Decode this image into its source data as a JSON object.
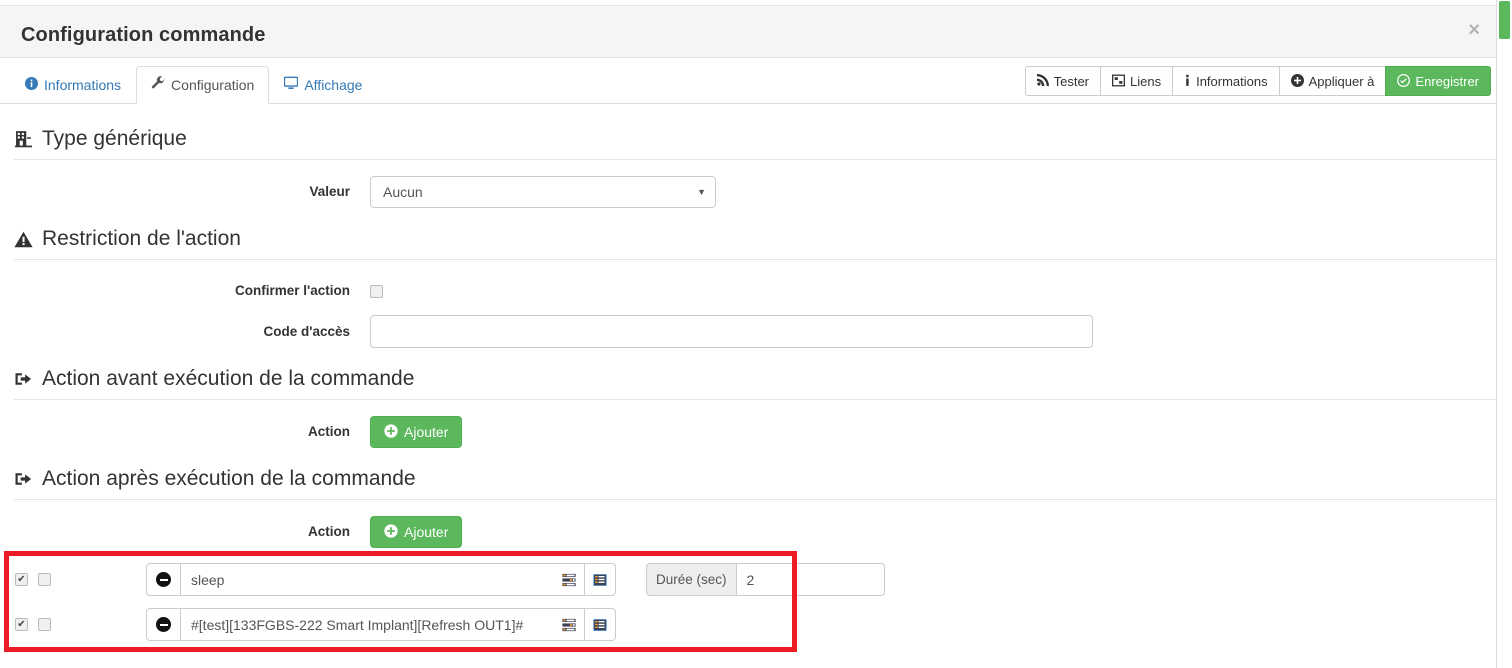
{
  "modal": {
    "title": "Configuration commande",
    "close_label": "×"
  },
  "tabs": [
    {
      "label": "Informations",
      "icon": "info-circle-icon",
      "active": false
    },
    {
      "label": "Configuration",
      "icon": "wrench-icon",
      "active": true
    },
    {
      "label": "Affichage",
      "icon": "desktop-icon",
      "active": false
    }
  ],
  "toolbar": {
    "test_label": "Tester",
    "links_label": "Liens",
    "informations_label": "Informations",
    "apply_to_label": "Appliquer à",
    "save_label": "Enregistrer",
    "save_color": "#5cb85c"
  },
  "sections": {
    "generic_type": {
      "title": "Type générique",
      "icon": "building-icon",
      "value_label": "Valeur",
      "value_selected": "Aucun"
    },
    "restriction": {
      "title": "Restriction de l'action",
      "icon": "warning-triangle-icon",
      "confirm_label": "Confirmer l'action",
      "confirm_checked": false,
      "access_code_label": "Code d'accès",
      "access_code_value": "",
      "access_code_placeholder": ""
    },
    "action_before": {
      "title": "Action avant exécution de la commande",
      "icon": "sign-out-icon",
      "action_label": "Action",
      "add_label": "Ajouter"
    },
    "action_after": {
      "title": "Action après exécution de la commande",
      "icon": "sign-out-icon",
      "action_label": "Action",
      "add_label": "Ajouter"
    }
  },
  "action_rows": [
    {
      "enabled_checked": true,
      "secondary_checked": false,
      "remove_icon": "minus-circle-icon",
      "command": "sleep",
      "option_icon_1": "sliders-icon",
      "option_icon_2": "list-alt-icon",
      "option_label": "Durée (sec)",
      "option_value": "2",
      "has_option": true
    },
    {
      "enabled_checked": true,
      "secondary_checked": false,
      "remove_icon": "minus-circle-icon",
      "command": "#[test][133FGBS-222 Smart Implant][Refresh OUT1]#",
      "option_icon_1": "sliders-icon",
      "option_icon_2": "list-alt-icon",
      "option_label": "",
      "option_value": "",
      "has_option": false
    }
  ],
  "highlight": {
    "color": "#ed1c24"
  }
}
